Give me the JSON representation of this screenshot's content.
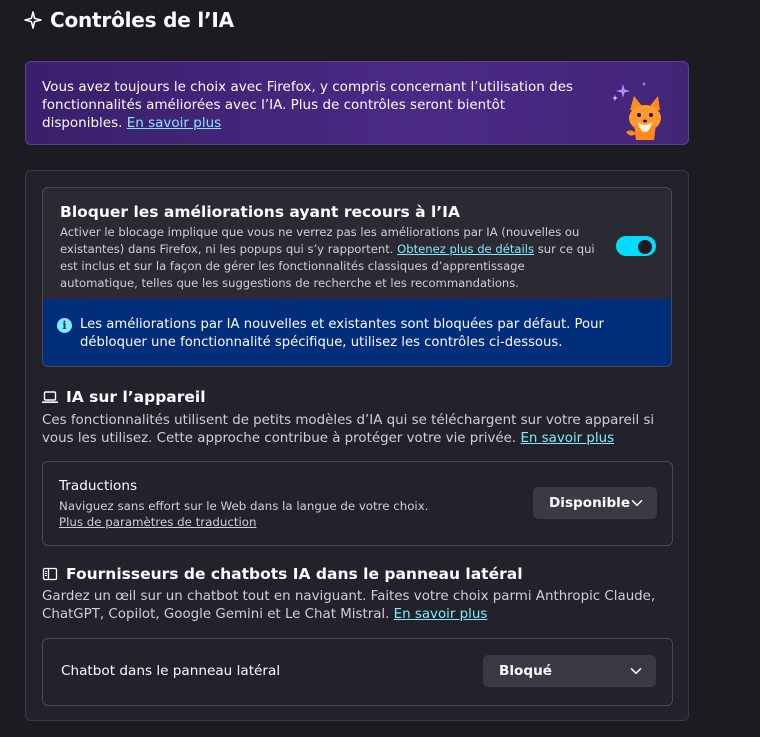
{
  "header": {
    "title": "Contrôles de l’IA"
  },
  "banner": {
    "text": "Vous avez toujours le choix avec Firefox, y compris concernant l’utilisation des fonctionnalités améliorées avec l’IA. Plus de contrôles seront bientôt disponibles.",
    "link": "En savoir plus"
  },
  "block": {
    "title": "Bloquer les améliorations ayant recours à l’IA",
    "desc_before": "Activer le blocage implique que vous ne verrez pas les améliorations par IA (nouvelles ou existantes) dans Firefox, ni les popups qui s’y rapportent.",
    "desc_link": "Obtenez plus de détails",
    "desc_after": "sur ce qui est inclus et sur la façon de gérer les fonctionnalités classiques d’apprentissage automatique, telles que les suggestions de recherche et les recommandations.",
    "toggle_on": true,
    "info_icon": "info-icon",
    "info_text": "Les améliorations par IA nouvelles et existantes sont bloquées par défaut. Pour débloquer une fonctionnalité spécifique, utilisez les contrôles ci-dessous."
  },
  "on_device": {
    "icon": "laptop-icon",
    "title": "IA sur l’appareil",
    "desc": "Ces fonctionnalités utilisent de petits modèles d’IA qui se téléchargent sur votre appareil si vous les utilisez. Cette approche contribue à protéger votre vie privée.",
    "link": "En savoir plus",
    "translations": {
      "label": "Traductions",
      "sub": "Naviguez sans effort sur le Web dans la langue de votre choix.",
      "link": "Plus de paramètres de traduction",
      "value": "Disponible"
    }
  },
  "chatbots": {
    "icon": "sidebar-icon",
    "title": "Fournisseurs de chatbots IA dans le panneau latéral",
    "desc": "Gardez un œil sur un chatbot tout en naviguant. Faites votre choix parmi Anthropic Claude, ChatGPT, Copilot, Google Gemini et Le Chat Mistral.",
    "link": "En savoir plus",
    "setting": {
      "label": "Chatbot dans le panneau latéral",
      "value": "Bloqué"
    }
  },
  "colors": {
    "background": "#1c1b22",
    "accent": "#00ddff",
    "link": "#80ebff",
    "info_bg": "#002e7a",
    "banner_bg": "#3a1f6b"
  }
}
